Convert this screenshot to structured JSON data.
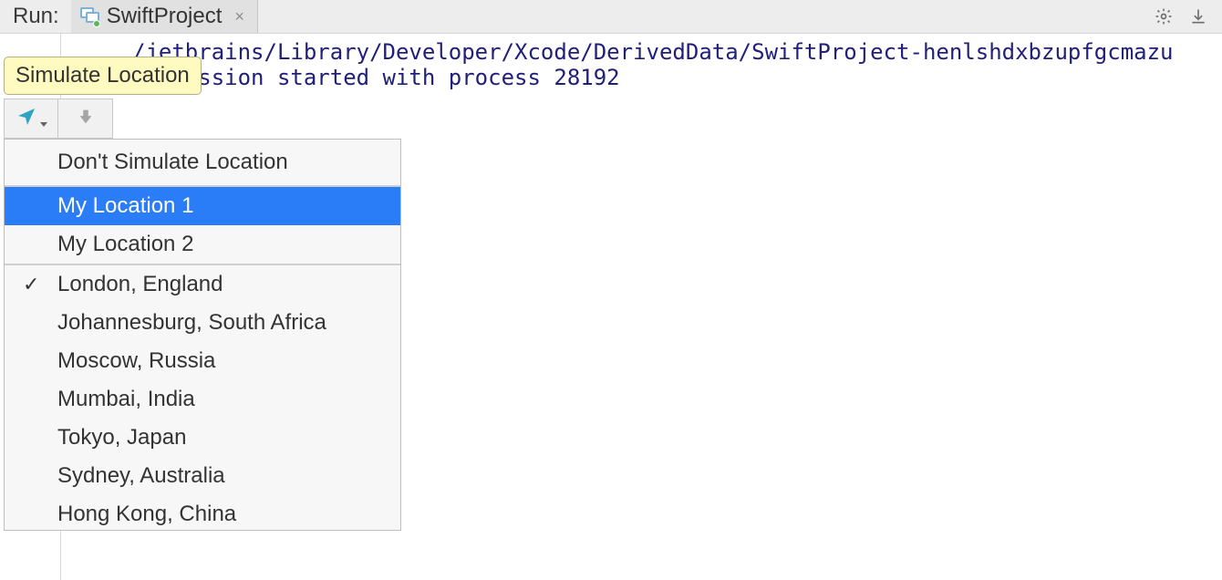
{
  "header": {
    "run_label": "Run:",
    "tab_title": "SwiftProject"
  },
  "tooltip": {
    "text": "Simulate Location"
  },
  "console": {
    "line1": "/jetbrains/Library/Developer/Xcode/DerivedData/SwiftProject-henlshdxbzupfgcmazu",
    "line2": "or session started with process 28192"
  },
  "menu": {
    "dont_simulate": "Don't Simulate Location",
    "custom": [
      "My Location 1",
      "My Location 2"
    ],
    "selected_custom_index": 0,
    "checked_preset": "London, England",
    "presets": [
      "London, England",
      "Johannesburg, South Africa",
      "Moscow, Russia",
      "Mumbai, India",
      "Tokyo, Japan",
      "Sydney, Australia",
      "Hong Kong, China"
    ]
  }
}
